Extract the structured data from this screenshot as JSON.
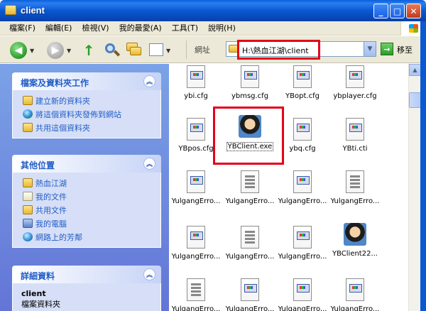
{
  "window": {
    "title": "client",
    "buttons": {
      "minimize": "_",
      "maximize": "□",
      "close": "✕"
    }
  },
  "menu": [
    "檔案(F)",
    "編輯(E)",
    "檢視(V)",
    "我的最愛(A)",
    "工具(T)",
    "說明(H)"
  ],
  "toolbar": {
    "back_icon": "back-arrow-icon",
    "address_label": "網址",
    "address_value": "H:\\熱血江湖\\client",
    "go_label": "移至"
  },
  "tasks_panel": {
    "title": "檔案及資料夾工作",
    "items": [
      "建立新的資料夾",
      "將這個資料夾發佈到網站",
      "共用這個資料夾"
    ]
  },
  "places_panel": {
    "title": "其他位置",
    "items": [
      "熱血江湖",
      "我的文件",
      "共用文件",
      "我的電腦",
      "網路上的芳鄰"
    ]
  },
  "details_panel": {
    "title": "詳細資料",
    "name": "client",
    "type": "檔案資料夾"
  },
  "files": [
    "ybi.cfg",
    "ybmsg.cfg",
    "YBopt.cfg",
    "ybplayer.cfg",
    "YBpos.cfg",
    "YBClient.exe",
    "ybq.cfg",
    "YBti.cti",
    "YulgangErro...",
    "YulgangErro...",
    "YulgangErro...",
    "YulgangErro...",
    "YulgangErro...",
    "YulgangErro...",
    "YulgangErro...",
    "YBClient22...",
    "YulgangErro...",
    "YulgangErro...",
    "YulgangErro...",
    "YulgangErro..."
  ],
  "colors": {
    "title_bar": "#0a58d2",
    "task_link": "#215dc6",
    "highlight": "#e4001a"
  }
}
